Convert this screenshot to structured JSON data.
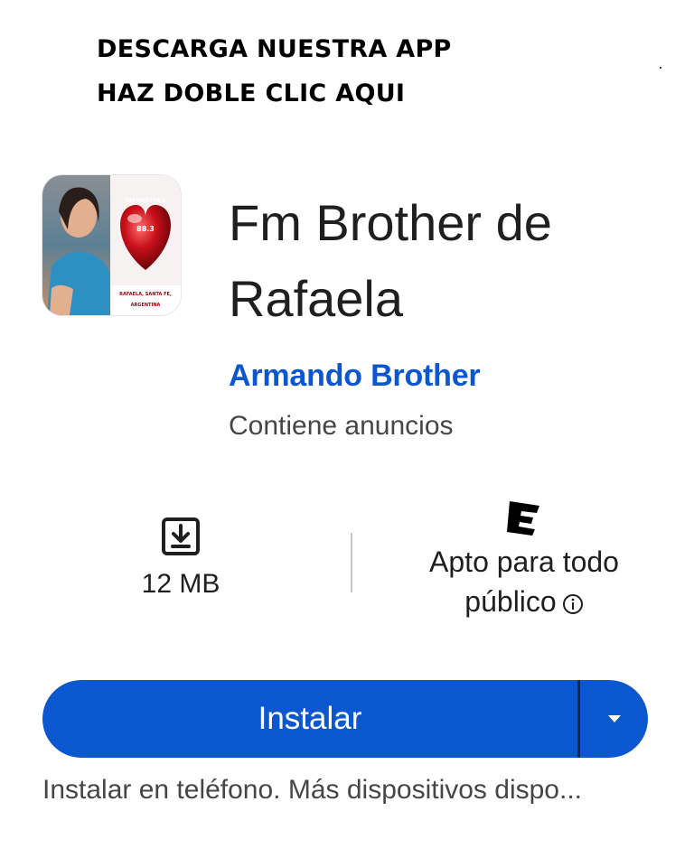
{
  "banner": {
    "line1": "DESCARGA NUESTRA APP",
    "line2": "HAZ DOBLE CLIC AQUI"
  },
  "app": {
    "icon_name": "app-icon",
    "icon_texts": {
      "top": "FM BROTHER",
      "freq": "88.3",
      "city": "RAFAELA, SANTA FE,",
      "country": "ARGENTINA"
    },
    "title": "Fm Brother de Rafaela",
    "developer": "Armando Brother",
    "ads_note": "Contiene anuncios"
  },
  "stats": {
    "size_icon": "download-icon",
    "size": "12 MB",
    "rating_icon": "esrb-everyone-icon",
    "rating_line1": "Apto para todo",
    "rating_line2": "público",
    "info_icon": "info-icon"
  },
  "install": {
    "label": "Instalar",
    "more_icon": "dropdown-arrow-icon",
    "note": "Instalar en teléfono. Más dispositivos dispo..."
  },
  "colors": {
    "accent": "#0b57d0",
    "text_primary": "#1f1f1f",
    "text_secondary": "#444746"
  }
}
